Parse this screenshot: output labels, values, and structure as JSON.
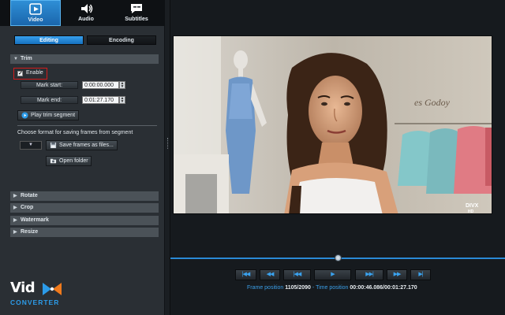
{
  "tabs": [
    {
      "label": "Video",
      "icon": "video-icon",
      "active": true
    },
    {
      "label": "Audio",
      "icon": "speaker-icon",
      "active": false
    },
    {
      "label": "Subtitles",
      "icon": "subtitles-icon",
      "active": false
    }
  ],
  "subtabs": [
    {
      "label": "Editing",
      "active": true
    },
    {
      "label": "Encoding",
      "active": false
    }
  ],
  "trim": {
    "title": "Trim",
    "enable_label": "Enable",
    "enabled": true,
    "mark_start_label": "Mark start:",
    "mark_start_value": "0:00:00.000",
    "mark_end_label": "Mark end:",
    "mark_end_value": "0:01:27.170",
    "play_segment_label": "Play trim segment",
    "format_caption": "Choose format for saving frames from segment",
    "save_frames_label": "Save frames as files...",
    "open_folder_label": "Open folder"
  },
  "sections": [
    "Rotate",
    "Crop",
    "Watermark",
    "Resize"
  ],
  "logo": {
    "top": "Vid",
    "bottom": "CONVERTER"
  },
  "preview": {
    "watermark": "DIVX",
    "watermark_sub": "HD",
    "sign_text": "es Godoy"
  },
  "timeline": {
    "position_fraction": 0.5
  },
  "status": {
    "frame_label": "Frame position",
    "frame_value": "1105/2090",
    "sep": "-",
    "time_label": "Time position",
    "time_value": "00:00:46.086/00:01:27.170"
  },
  "colors": {
    "accent": "#2c9be8",
    "highlight_border": "#d21b1b",
    "logo_orange": "#f07a1c"
  }
}
